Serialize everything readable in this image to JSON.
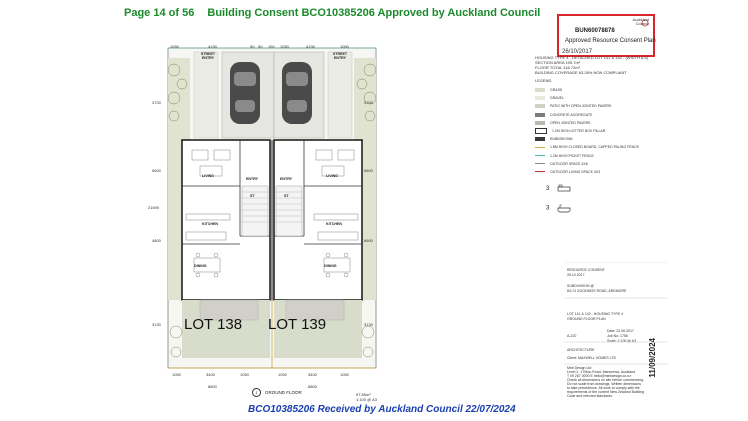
{
  "header": {
    "page_label": "Page 14 of 56",
    "title": "Building Consent BCO10385206 Approved by Auckland Council"
  },
  "stamp": {
    "id": "BUN60078878",
    "text": "Approved Resource Consent Plan",
    "date": "26/10/2017",
    "logo_text": [
      "Auckland",
      "Council"
    ],
    "border_color": "#d9262e"
  },
  "footer": {
    "text": "BCO10385206 Received by Auckland Council 22/07/2024",
    "color": "#1a3fb0"
  },
  "plan": {
    "lots": [
      "LOT 138",
      "LOT 139"
    ],
    "top_labels": [
      "STREET ENTRY",
      "STREET ENTRY"
    ],
    "room_labels": {
      "living_left": "LIVING",
      "living_right": "LIVING",
      "entry_left": "ENTRY",
      "entry_right": "ENTRY",
      "kitchen_left": "KITCHEN",
      "kitchen_right": "KITCHEN",
      "dining_left": "DINING",
      "dining_right": "DINING",
      "st_left": "ST",
      "st_right": "ST"
    },
    "top_dims": [
      "1050",
      "4190",
      "90",
      "90",
      "150",
      "1050",
      "4190",
      "1050"
    ],
    "bottom_dims": [
      "1050",
      "3400",
      "1050",
      "1050",
      "3400",
      "1050"
    ],
    "bottom_total": "8800",
    "title_num": "1",
    "title_text": "GROUND FLOOR",
    "area_text": [
      "97.85m²",
      "1:100 @ A3"
    ],
    "left_dims": [
      "21690",
      "3700",
      "5600",
      "4800",
      "3130"
    ],
    "right_dims": [
      "3700",
      "5600",
      "6600",
      "3130"
    ]
  },
  "info": [
    "HOUSING TYPE 4 - DETACHED LOT 141 & 142 - (WIDTH 8.8)",
    "SECTION AREA                  195.7m²",
    "FLOOR TOTAL                  116.72m²",
    "BUILDING COVERAGE     63.26% NON COMPLIANT"
  ],
  "legend": {
    "title": "LEGEND",
    "items": [
      {
        "label": "GRASS",
        "color": "#d9dfc6"
      },
      {
        "label": "GRAVEL",
        "color": "#e8eadd"
      },
      {
        "label": "PATIO WITH OPEN JOINTED PAVERS",
        "color": "#cfd0c6"
      },
      {
        "label": "CONCRETE AGGREGATE",
        "color": "#7c7c7c"
      },
      {
        "label": "OPEN JOINTED PAVERS",
        "color": "#b9b9b0"
      },
      {
        "label": "1.2M HIGH LETTER BOX PILLAR",
        "color": "#ffffff"
      },
      {
        "label": "RUBBISH BIN",
        "color": "#3a3a3a"
      },
      {
        "label": "1.8M HIGH CLOSED BOARD, CAPPED PALING FENCE",
        "color": "#d9a440"
      },
      {
        "label": "1.2M HIGH PICKET FENCE",
        "color": "#4fb8b0"
      },
      {
        "label": "OUTDOOR SPACE 4X6",
        "color": "#888888"
      },
      {
        "label": "OUTDOOR LIVING SPACE 4X3",
        "color": "#bb3333"
      }
    ],
    "symbols": [
      "3",
      "3"
    ]
  },
  "title_block": {
    "resource": [
      "RESOURCE CONSENT",
      "26.10.2017"
    ],
    "client": [
      "SUBDIVISION @",
      "84-74 GOODMOS ROAD, ARDMORE"
    ],
    "drawing": [
      "LOT 141 & 142 - HOUSING TYPE 4",
      "GROUND FLOOR PLAN"
    ],
    "meta": [
      "Date:        22.06.2017",
      "Job No:      1756",
      "Scale:       1:100 @ A3"
    ],
    "sheet": "A-210",
    "firm": "ARCHITECTURE",
    "client_name": "Client:   MAXWELL HOMES LTD",
    "address": [
      "Mint Design Ltd",
      "Level 2, 1 Rimu Road, Manurewa, Auckland",
      "T 09 267 0000  E hello@mintdesign.co.nz",
      "Check all dimensions on site before commencing.",
      "Do not scale from drawings. Written dimensions",
      "to take precedence. All work to comply with the",
      "requirements of the current New Zealand Building",
      "Code and relevant standards."
    ],
    "vertical_date": "11/09/2024"
  }
}
